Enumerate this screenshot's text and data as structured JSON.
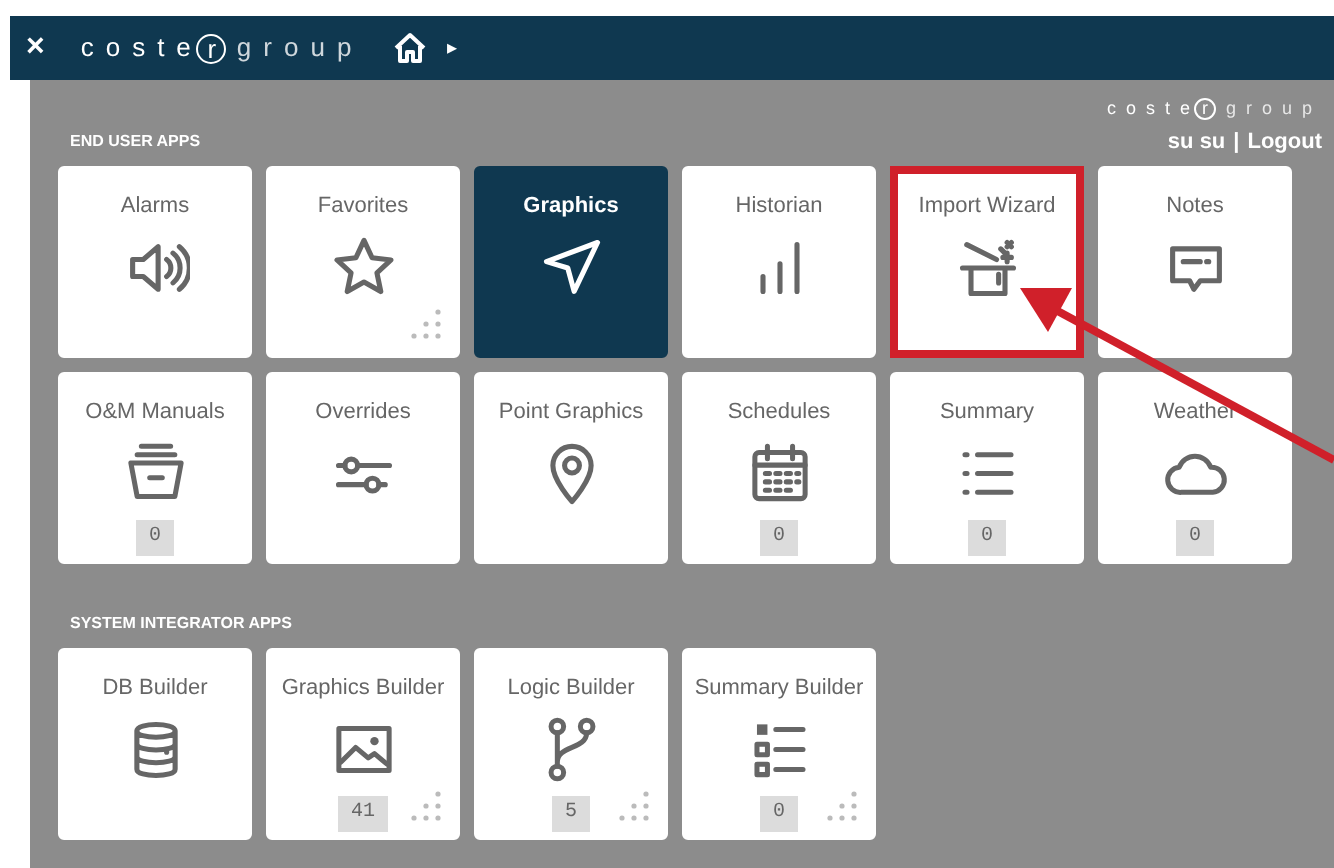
{
  "top_bar": {
    "close": "×",
    "logo": {
      "first": "coste",
      "mark": "r",
      "last": "group"
    },
    "chevron": "▸"
  },
  "header": {
    "logo": {
      "first": "coste",
      "mark": "r",
      "last": "group"
    },
    "user": "su su",
    "separator": "|",
    "logout": "Logout"
  },
  "sections": [
    {
      "title": "END USER APPS",
      "tiles": [
        {
          "label": "Alarms",
          "selected": false,
          "grip": false,
          "highlighted": false
        },
        {
          "label": "Favorites",
          "selected": false,
          "grip": true,
          "highlighted": false
        },
        {
          "label": "Graphics",
          "selected": true,
          "grip": false,
          "highlighted": false
        },
        {
          "label": "Historian",
          "selected": false,
          "grip": false,
          "highlighted": false
        },
        {
          "label": "Import Wizard",
          "selected": false,
          "grip": false,
          "highlighted": true
        },
        {
          "label": "Notes",
          "selected": false,
          "grip": false,
          "highlighted": false
        },
        {
          "label": "O&M Manuals",
          "selected": false,
          "grip": false,
          "highlighted": false,
          "badge": "0"
        },
        {
          "label": "Overrides",
          "selected": false,
          "grip": false,
          "highlighted": false
        },
        {
          "label": "Point Graphics",
          "selected": false,
          "grip": false,
          "highlighted": false
        },
        {
          "label": "Schedules",
          "selected": false,
          "grip": false,
          "highlighted": false,
          "badge": "0"
        },
        {
          "label": "Summary",
          "selected": false,
          "grip": false,
          "highlighted": false,
          "badge": "0"
        },
        {
          "label": "Weather",
          "selected": false,
          "grip": false,
          "highlighted": false,
          "badge": "0"
        }
      ]
    },
    {
      "title": "SYSTEM INTEGRATOR APPS",
      "tiles": [
        {
          "label": "DB Builder",
          "selected": false,
          "grip": false,
          "highlighted": false
        },
        {
          "label": "Graphics Builder",
          "selected": false,
          "grip": true,
          "highlighted": false,
          "badge": "41"
        },
        {
          "label": "Logic Builder",
          "selected": false,
          "grip": true,
          "highlighted": false,
          "badge": "5"
        },
        {
          "label": "Summary Builder",
          "selected": false,
          "grip": true,
          "highlighted": false,
          "badge": "0"
        }
      ]
    }
  ],
  "annotation": {
    "kind": "arrow"
  }
}
